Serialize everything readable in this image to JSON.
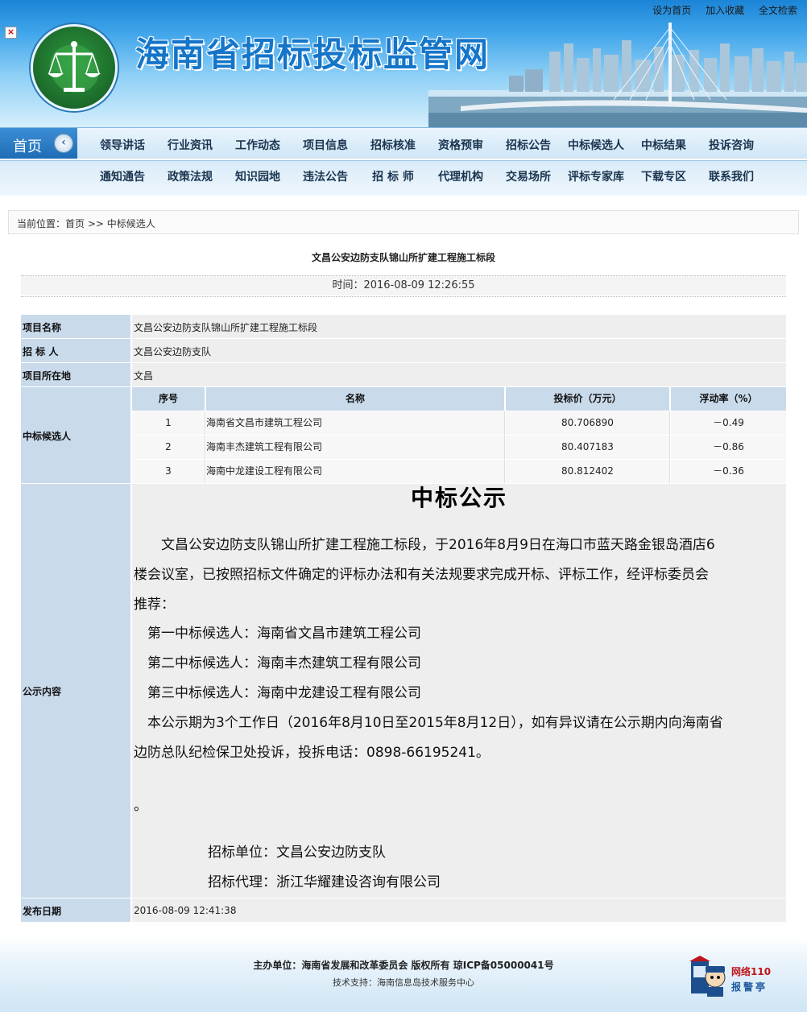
{
  "header": {
    "top_links": [
      "设为首页",
      "加入收藏",
      "全文检索"
    ],
    "site_title": "海南省招标投标监管网"
  },
  "nav": {
    "home": "首页",
    "row1": [
      "领导讲话",
      "行业资讯",
      "工作动态",
      "项目信息",
      "招标核准",
      "资格预审",
      "招标公告",
      "中标候选人",
      "中标结果",
      "投诉咨询"
    ],
    "row2": [
      "通知通告",
      "政策法规",
      "知识园地",
      "违法公告",
      "招 标 师",
      "代理机构",
      "交易场所",
      "评标专家库",
      "下载专区",
      "联系我们"
    ]
  },
  "breadcrumb": {
    "prefix": "当前位置：",
    "home": "首页",
    "separator": " >> ",
    "current": "中标候选人"
  },
  "article": {
    "title": "文昌公安边防支队锦山所扩建工程施工标段",
    "time": "时间：2016-08-09 12:26:55"
  },
  "info": {
    "project_name_label": "项目名称",
    "project_name": "文昌公安边防支队锦山所扩建工程施工标段",
    "tenderer_label": "招 标 人",
    "tenderer": "文昌公安边防支队",
    "location_label": "项目所在地",
    "location": "文昌",
    "candidates_label": "中标候选人",
    "candidate_headers": [
      "序号",
      "名称",
      "投标价（万元）",
      "浮动率（%）"
    ],
    "candidates": [
      {
        "no": "1",
        "name": "海南省文昌市建筑工程公司",
        "price": "80.706890",
        "rate": "－0.49"
      },
      {
        "no": "2",
        "name": "海南丰杰建筑工程有限公司",
        "price": "80.407183",
        "rate": "－0.86"
      },
      {
        "no": "3",
        "name": "海南中龙建设工程有限公司",
        "price": "80.812402",
        "rate": "－0.36"
      }
    ],
    "notice_label": "公示内容",
    "publish_label": "发布日期",
    "publish_date": "2016-08-09 12:41:38"
  },
  "notice": {
    "heading": "中标公示",
    "p1_line1": "　　文昌公安边防支队锦山所扩建工程施工标段，于2016年8月9日在海口市蓝天路金银岛酒店6",
    "p1_line2": "楼会议室，已按照招标文件确定的评标办法和有关法规要求完成开标、评标工作，经评标委员会",
    "p1_line3": "推荐：",
    "c1": "　第一中标候选人：海南省文昌市建筑工程公司",
    "c2": "　第二中标候选人：海南丰杰建筑工程有限公司",
    "c3": "　第三中标候选人：海南中龙建设工程有限公司",
    "p2_line1": "　本公示期为3个工作日（2016年8月10日至2015年8月12日），如有异议请在公示期内向海南省",
    "p2_line2": "边防总队纪检保卫处投诉，投拆电话：0898-66195241。",
    "dot": "。",
    "tender_unit": "招标单位：文昌公安边防支队",
    "tender_agent": "招标代理：浙江华耀建设咨询有限公司"
  },
  "footer": {
    "line1": "主办单位：海南省发展和改革委员会  版权所有   琼ICP备05000041号",
    "line2": "技术支持：海南信息岛技术服务中心",
    "badge_line1": "网络110",
    "badge_line2": "报警亭"
  }
}
